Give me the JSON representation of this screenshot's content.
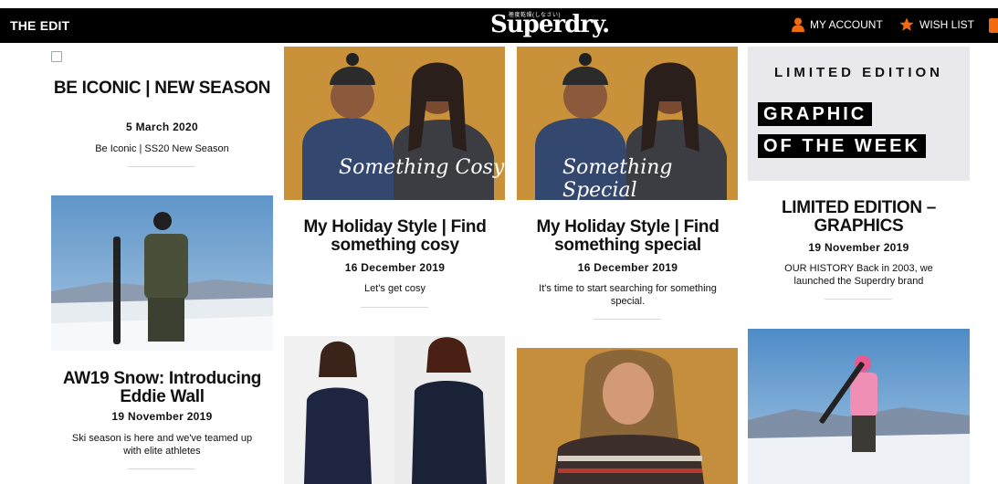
{
  "header": {
    "edit_label": "THE EDIT",
    "logo_text": "Superdry.",
    "logo_kana": "極度乾燥(しなさい)",
    "account_label": "MY ACCOUNT",
    "wishlist_label": "WISH LIST",
    "accent_color": "#f26a10"
  },
  "articles": [
    {
      "title": "BE ICONIC | NEW SEASON",
      "date": "5 March 2020",
      "desc": "Be Iconic | SS20 New Season"
    },
    {
      "title": "AW19 Snow: Introducing Eddie Wall",
      "date": "19 November 2019",
      "desc": "Ski season is here and we've teamed up with elite athletes"
    },
    {
      "overlay": "Something Cosy",
      "title": "My Holiday Style | Find something cosy",
      "date": "16 December 2019",
      "desc": "Let's get cosy"
    },
    {
      "overlay": "Something Special",
      "title": "My Holiday Style | Find something special",
      "date": "16 December 2019",
      "desc": "It's time to start searching for something special."
    },
    {
      "banner_line1": "LIMITED EDITION",
      "banner_line2": "GRAPHIC",
      "banner_line3": "OF THE WEEK",
      "title": "LIMITED EDITION – GRAPHICS",
      "date": "19 November 2019",
      "desc": "OUR HISTORY   Back in 2003, we launched the Superdry brand"
    }
  ]
}
